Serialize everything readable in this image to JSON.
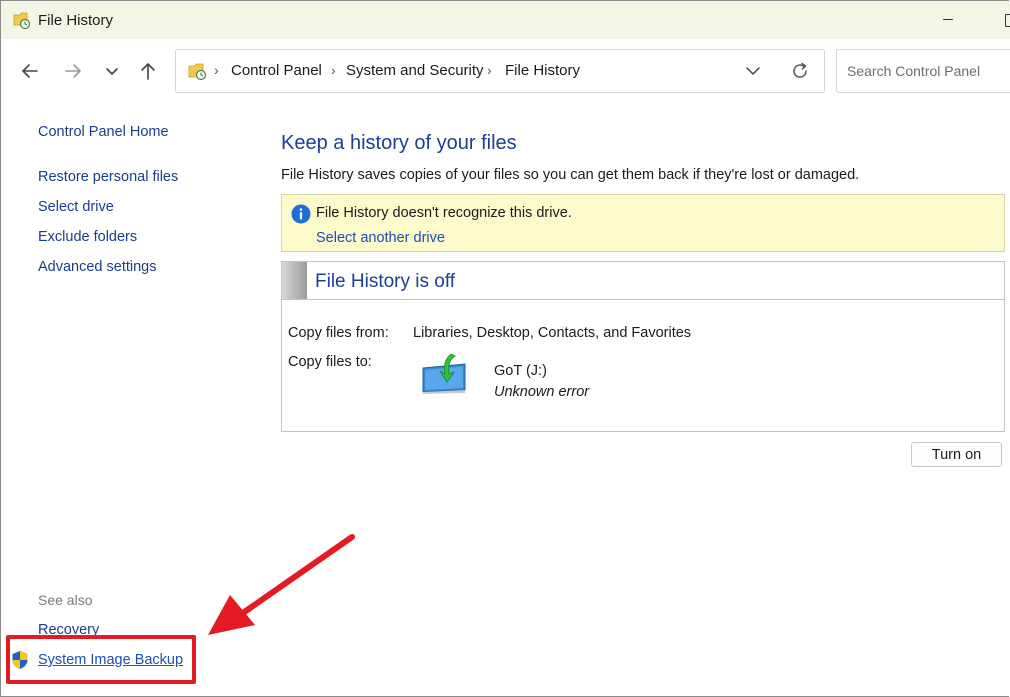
{
  "window": {
    "title": "File History",
    "colors": {
      "titlebar": "#f3f6e6",
      "link": "#1a3d8f",
      "heading": "#1c3f94"
    }
  },
  "nav": {
    "back_icon": "arrow-left-icon",
    "forward_icon": "arrow-right-icon",
    "recent_icon": "chevron-down-icon",
    "up_icon": "arrow-up-icon"
  },
  "address": {
    "crumbs": [
      "Control Panel",
      "System and Security",
      "File History"
    ],
    "separator": "›"
  },
  "search": {
    "placeholder": "Search Control Panel"
  },
  "sidebar": {
    "home": "Control Panel Home",
    "items": [
      {
        "label": "Restore personal files"
      },
      {
        "label": "Select drive"
      },
      {
        "label": "Exclude folders"
      },
      {
        "label": "Advanced settings"
      }
    ],
    "see_also_title": "See also",
    "see_also": [
      {
        "label": "Recovery"
      },
      {
        "label": "System Image Backup"
      }
    ]
  },
  "main": {
    "heading": "Keep a history of your files",
    "description": "File History saves copies of your files so you can get them back if they're lost or damaged.",
    "notice": {
      "text": "File History doesn't recognize this drive.",
      "link": "Select another drive",
      "background": "#fdfbcb"
    },
    "status": {
      "title": "File History is off",
      "copy_from_label": "Copy files from:",
      "copy_from_value": "Libraries, Desktop, Contacts, and Favorites",
      "copy_to_label": "Copy files to:",
      "drive_name": "GoT (J:)",
      "drive_status": "Unknown error"
    },
    "turn_on_label": "Turn on"
  },
  "annotation": {
    "color": "#e41b23"
  }
}
